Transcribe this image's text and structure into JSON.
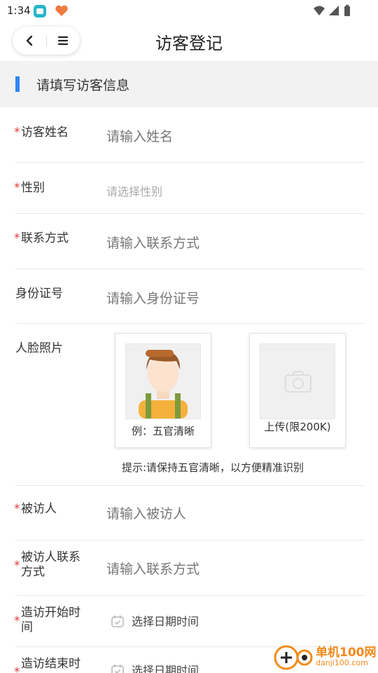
{
  "status_bar": {
    "time": "1:34"
  },
  "header": {
    "title": "访客登记"
  },
  "section": {
    "title": "请填写访客信息"
  },
  "form": {
    "name": {
      "label": "访客姓名",
      "placeholder": "请输入姓名",
      "required": true
    },
    "gender": {
      "label": "性别",
      "placeholder": "请选择性别",
      "required": true
    },
    "contact": {
      "label": "联系方式",
      "placeholder": "请输入联系方式",
      "required": true
    },
    "id_card": {
      "label": "身份证号",
      "placeholder": "请输入身份证号",
      "required": false
    },
    "face_photo": {
      "label": "人脸照片",
      "example_caption": "例：五官清晰",
      "upload_caption": "上传(限200K)",
      "hint": "提示:请保持五官清晰，以方便精准识别"
    },
    "visitee": {
      "label": "被访人",
      "placeholder": "请输入被访人",
      "required": true
    },
    "visitee_contact": {
      "label_line1": "被访人联系",
      "label_line2": "方式",
      "placeholder": "请输入联系方式",
      "required": true
    },
    "start_time": {
      "label_line1": "造访开始时",
      "label_line2": "间",
      "value": "选择日期时间",
      "required": true
    },
    "end_time": {
      "label_line1": "造访结束时",
      "value": "选择日期时间",
      "required": true
    }
  },
  "required_mark": "*",
  "watermark": {
    "name": "单机100网",
    "url": "danji100.com"
  },
  "colors": {
    "accent": "#2f86f6",
    "required": "#e03a3a",
    "section_bg": "#f2f2f2",
    "watermark": "#f28a1a"
  }
}
